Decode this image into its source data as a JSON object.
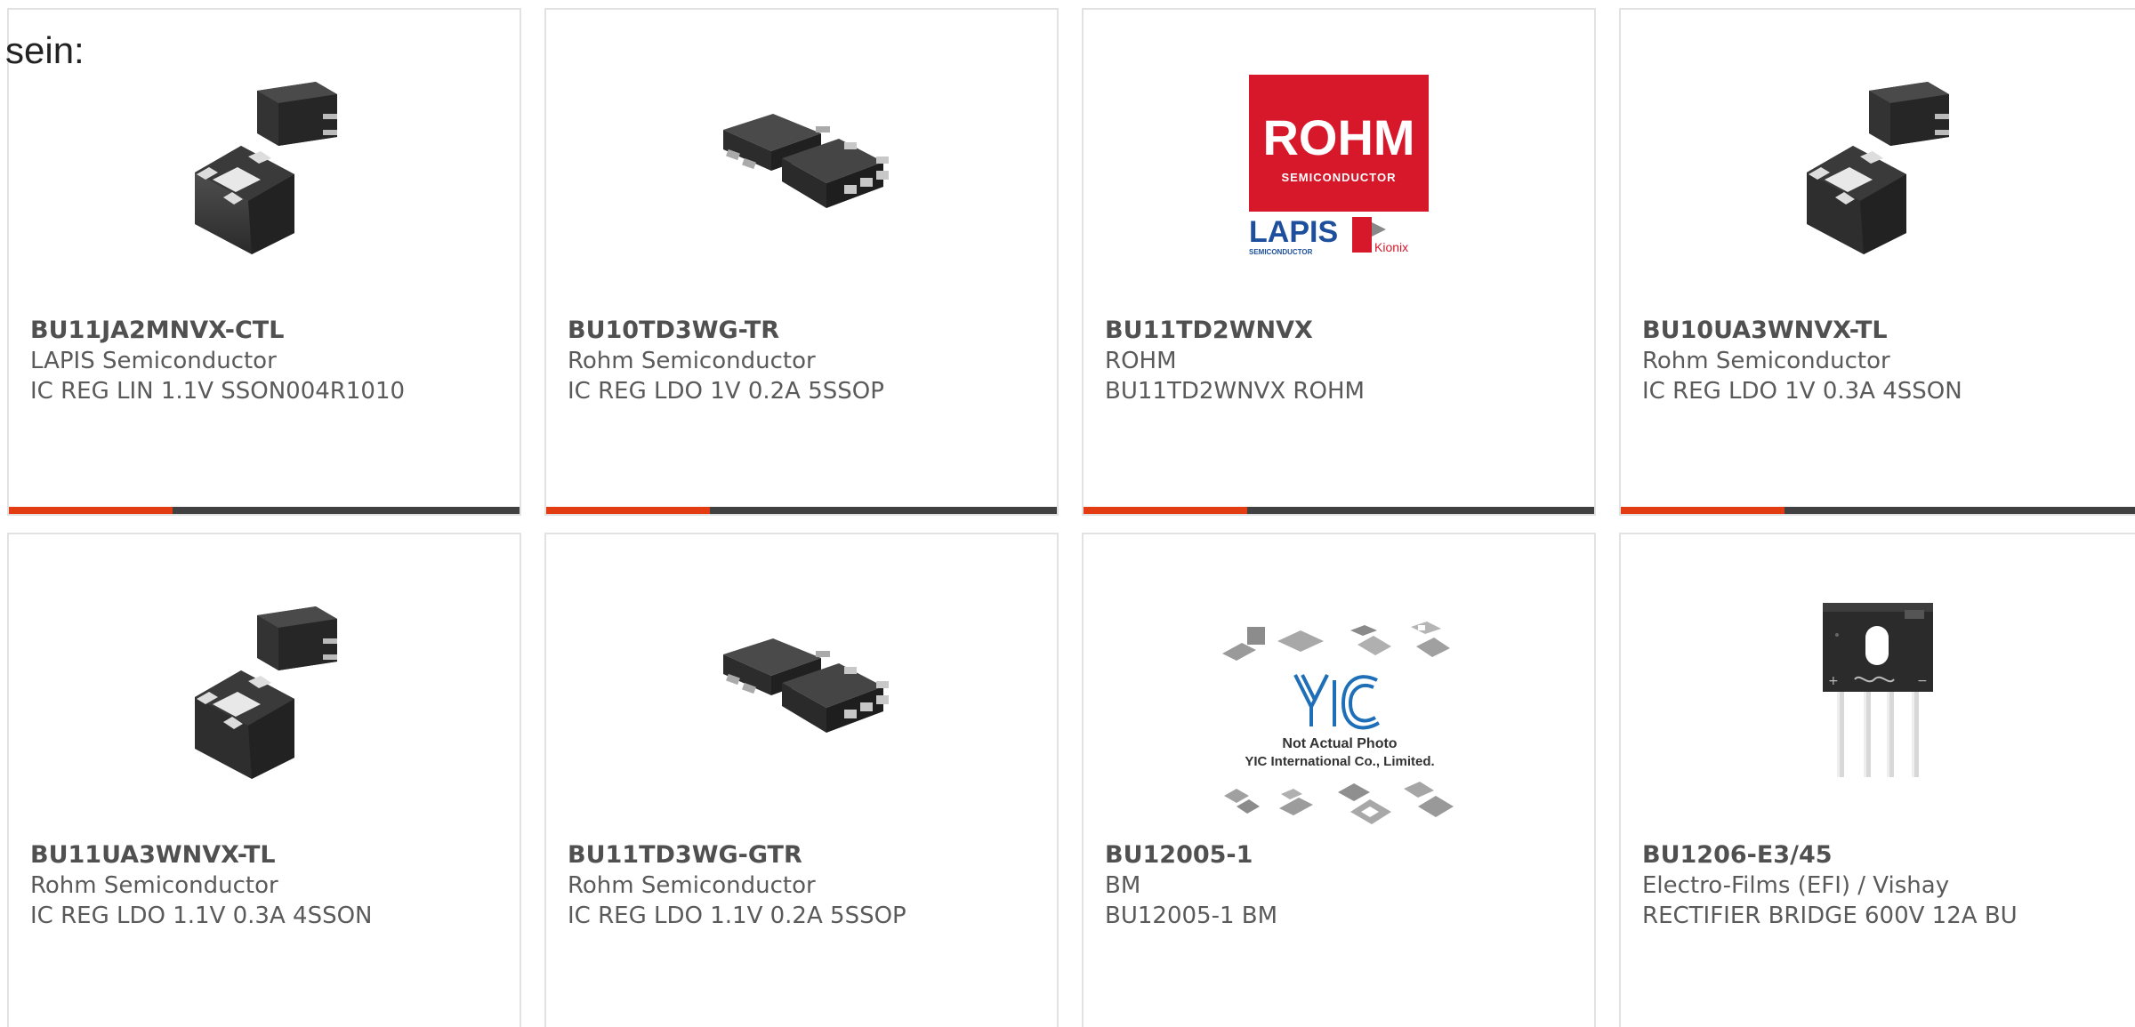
{
  "intro_text": "sein:",
  "accent_color": "#e43c12",
  "bar_color": "#414141",
  "products": [
    {
      "part_number": "BU11JA2MNVX-CTL",
      "manufacturer": "LAPIS Semiconductor",
      "description": "IC REG LIN 1.1V SSON004R1010",
      "image": "son-package-photo"
    },
    {
      "part_number": "BU10TD3WG-TR",
      "manufacturer": "Rohm Semiconductor",
      "description": "IC REG LDO 1V 0.2A 5SSOP",
      "image": "ssop-package-photo"
    },
    {
      "part_number": "BU11TD2WNVX",
      "manufacturer": "ROHM",
      "description": "BU11TD2WNVX ROHM",
      "image": "rohm-logo",
      "logo_text": {
        "brand": "ROHM",
        "brand_sub": "SEMICONDUCTOR",
        "lapis": "LAPIS",
        "lapis_sub": "SEMICONDUCTOR",
        "kionix": "Kionix"
      }
    },
    {
      "part_number": "BU10UA3WNVX-TL",
      "manufacturer": "Rohm Semiconductor",
      "description": "IC REG LDO 1V 0.3A 4SSON",
      "image": "son-package-photo"
    },
    {
      "part_number": "BU11UA3WNVX-TL",
      "manufacturer": "Rohm Semiconductor",
      "description": "IC REG LDO 1.1V 0.3A 4SSON",
      "image": "son-package-photo"
    },
    {
      "part_number": "BU11TD3WG-GTR",
      "manufacturer": "Rohm Semiconductor",
      "description": "IC REG LDO 1.1V 0.2A 5SSOP",
      "image": "ssop-package-photo"
    },
    {
      "part_number": "BU12005-1",
      "manufacturer": "BM",
      "description": "BU12005-1 BM",
      "image": "yic-placeholder",
      "placeholder_text": {
        "line1": "Not Actual Photo",
        "line2": "YIC International Co., Limited."
      }
    },
    {
      "part_number": "BU1206-E3/45",
      "manufacturer": "Electro-Films (EFI) / Vishay",
      "description": "RECTIFIER BRIDGE 600V 12A BU",
      "image": "bridge-rectifier-photo"
    }
  ]
}
